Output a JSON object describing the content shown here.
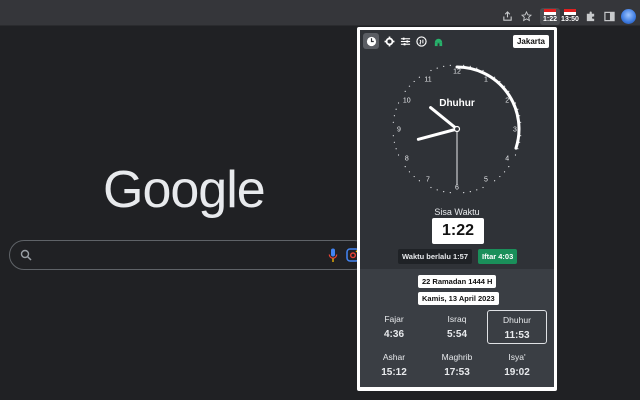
{
  "browser": {
    "ext_badges": [
      {
        "name": "prayer-time-ext",
        "text": "1:22",
        "flag_top": "#e02020",
        "flag_bottom": "#ffffff"
      },
      {
        "name": "time-ext",
        "text": "13:50",
        "flag_top": "#e02020",
        "flag_bottom": "#ffffff"
      }
    ]
  },
  "newtab": {
    "logo_text": "Google"
  },
  "popup": {
    "city": "Jakarta",
    "current_prayer": "Dhuhur",
    "clock": {
      "numbers": [
        "12",
        "1",
        "2",
        "3",
        "4",
        "5",
        "6",
        "7",
        "8",
        "9",
        "10",
        "11"
      ],
      "hour_hand": 10.3,
      "minute_hand": 8.5,
      "progress_arc_fraction": 0.3
    },
    "sisa_label": "Sisa Waktu",
    "sisa_value": "1:22",
    "elapsed_chip": "Waktu berlalu 1:57",
    "iftar_chip": "Iftar 4:03",
    "hijri_date": "22 Ramadan 1444 H",
    "gregorian_date": "Kamis, 13 April 2023",
    "times": [
      {
        "name": "Fajar",
        "time": "4:36",
        "current": false
      },
      {
        "name": "Israq",
        "time": "5:54",
        "current": false
      },
      {
        "name": "Dhuhur",
        "time": "11:53",
        "current": true
      },
      {
        "name": "Ashar",
        "time": "15:12",
        "current": false
      },
      {
        "name": "Maghrib",
        "time": "17:53",
        "current": false
      },
      {
        "name": "Isya'",
        "time": "19:02",
        "current": false
      }
    ]
  },
  "colors": {
    "background": "#202124",
    "popup_bg": "#2f3237",
    "popup_lower_bg": "#3a3e44",
    "iftar_green": "#1a8f5a"
  },
  "icons": {
    "toolbar": [
      "share-icon",
      "star-icon",
      "puzzle-icon",
      "sidebar-icon",
      "avatar"
    ],
    "popup_toolbar": [
      "clock-icon",
      "gear-icon",
      "sliders-icon",
      "hijri-icon",
      "mosque-icon"
    ]
  }
}
